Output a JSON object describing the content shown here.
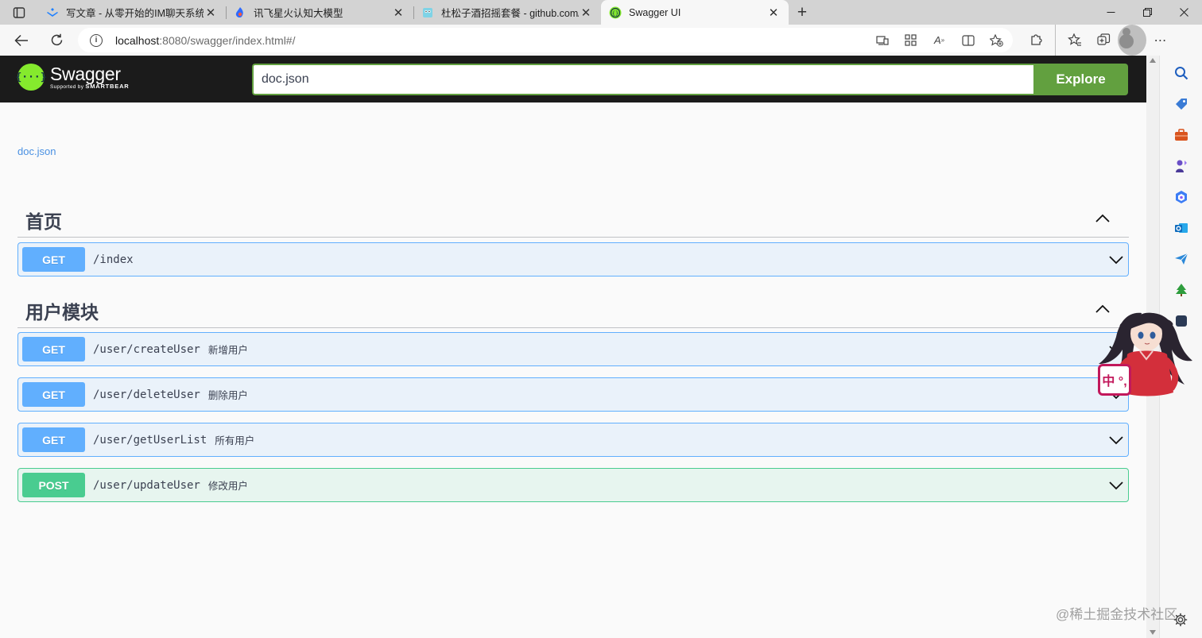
{
  "browser": {
    "tabs": [
      {
        "title": "写文章 - 从零开始的IM聊天系统",
        "active": false
      },
      {
        "title": "讯飞星火认知大模型",
        "active": false
      },
      {
        "title": "杜松子酒招摇套餐 - github.com/",
        "active": false
      },
      {
        "title": "Swagger UI",
        "active": true
      }
    ],
    "address": {
      "host": "localhost",
      "rest": ":8080/swagger/index.html#/"
    }
  },
  "swagger": {
    "logo_title": "Swagger",
    "logo_sub_prefix": "Supported by",
    "logo_sub_brand": "SMARTBEAR",
    "url_value": "doc.json",
    "explore_label": "Explore",
    "info_link": "doc.json"
  },
  "tags": [
    {
      "name": "首页",
      "operations": [
        {
          "method": "GET",
          "path": "/index",
          "summary": ""
        }
      ]
    },
    {
      "name": "用户模块",
      "operations": [
        {
          "method": "GET",
          "path": "/user/createUser",
          "summary": "新增用户"
        },
        {
          "method": "GET",
          "path": "/user/deleteUser",
          "summary": "删除用户"
        },
        {
          "method": "GET",
          "path": "/user/getUserList",
          "summary": "所有用户"
        },
        {
          "method": "POST",
          "path": "/user/updateUser",
          "summary": "修改用户"
        }
      ]
    }
  ],
  "overlay": {
    "ime_label": "中 °,",
    "watermark": "@稀土掘金技术社区"
  },
  "colors": {
    "get": "#61affe",
    "post": "#49cc90",
    "topbar": "#1b1b1b",
    "explore": "#62a03f",
    "link": "#4990e2"
  }
}
